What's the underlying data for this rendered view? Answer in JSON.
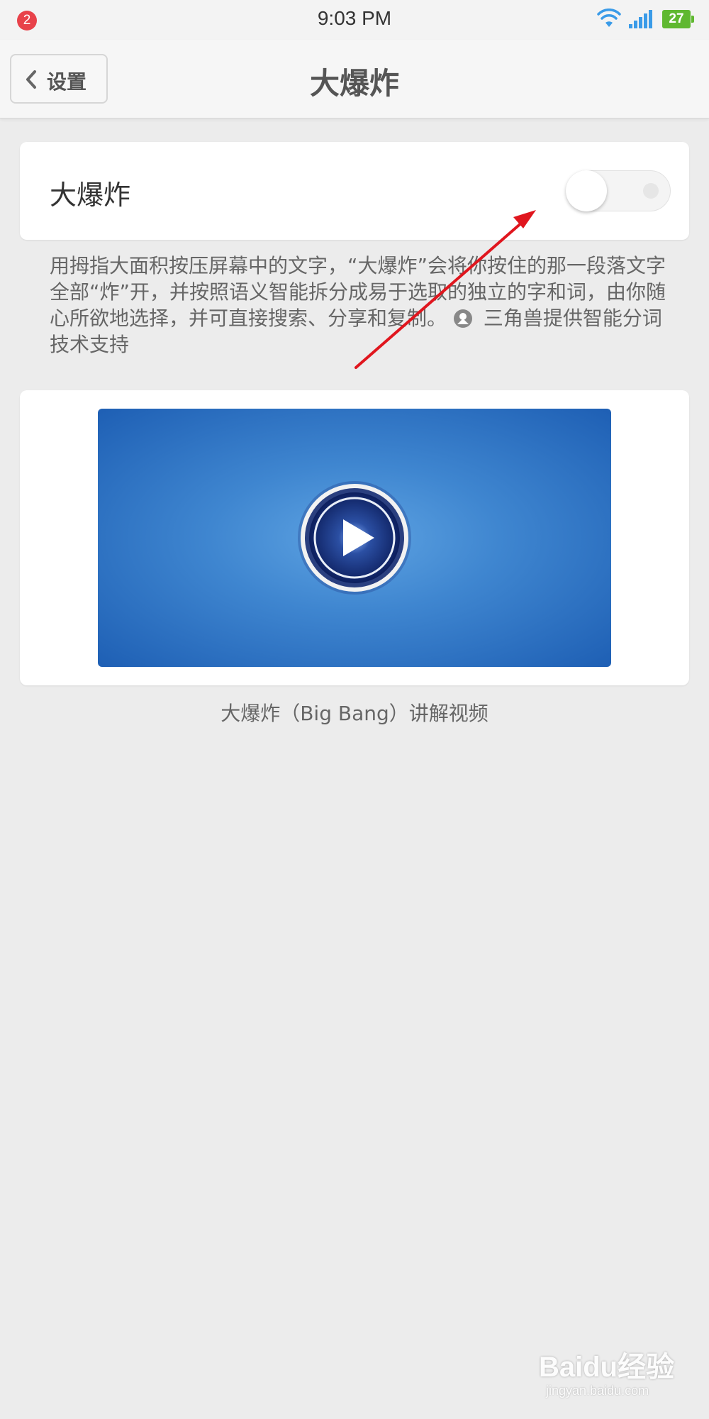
{
  "status_bar": {
    "notification_count": "2",
    "time": "9:03 PM",
    "battery": "27",
    "icons": [
      "wifi-icon",
      "signal-icon",
      "battery-icon"
    ]
  },
  "header": {
    "back_label": "设置",
    "title": "大爆炸"
  },
  "toggle": {
    "label": "大爆炸",
    "state": "off"
  },
  "description": {
    "text": "用拇指大面积按压屏幕中的文字，“大爆炸”会将你按住的那一段落文字全部“炸”开，并按照语义智能拆分成易于选取的独立的字和词，由你随心所欲地选择，并可直接搜索、分享和复制。",
    "provider_text": "三角兽提供智能分词技术支持"
  },
  "video": {
    "caption": "大爆炸（Big Bang）讲解视频"
  },
  "watermark": {
    "logo": "Baidu经验",
    "sub": "jingyan.baidu.com"
  },
  "colors": {
    "background": "#ececec",
    "card": "#ffffff",
    "annotation_arrow": "#e0161e",
    "video_blue": "#3f86d0",
    "badge_red": "#e8424a",
    "battery_green": "#5fb830",
    "wifi_blue": "#3a9be8"
  }
}
